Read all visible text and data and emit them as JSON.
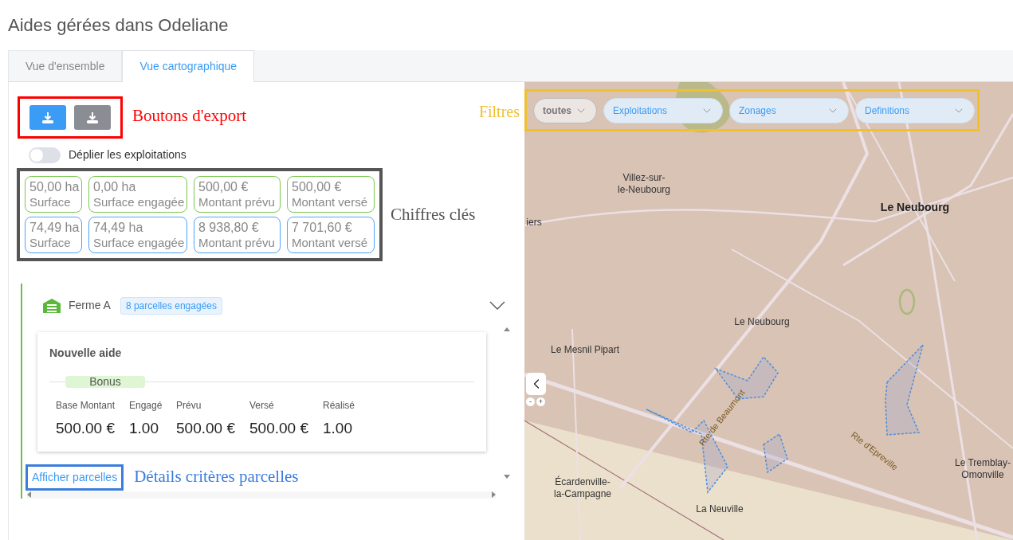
{
  "page_title": "Aides gérées dans Odeliane",
  "tabs": [
    {
      "label": "Vue d'ensemble",
      "selected": false
    },
    {
      "label": "Vue cartographique",
      "selected": true
    }
  ],
  "export_buttons": [
    {
      "color": "#3b9cf6"
    },
    {
      "color": "#8a8d93"
    }
  ],
  "toggle": {
    "label": "Déplier les exploitations",
    "on": false
  },
  "key_figures": [
    {
      "color": "#7ac74f",
      "cards": [
        {
          "value": "50,00 ha",
          "label": "Surface"
        },
        {
          "value": "0,00 ha",
          "label": "Surface engagée"
        },
        {
          "value": "500,00 €",
          "label": "Montant prévu"
        },
        {
          "value": "500,00 €",
          "label": "Montant versé"
        }
      ]
    },
    {
      "color": "#4da3f7",
      "cards": [
        {
          "value": "74,49 ha",
          "label": "Surface"
        },
        {
          "value": "74,49 ha",
          "label": "Surface engagée"
        },
        {
          "value": "8 938,80 €",
          "label": "Montant prévu"
        },
        {
          "value": "7 701,60 €",
          "label": "Montant versé"
        }
      ]
    }
  ],
  "farm": {
    "name": "Ferme A",
    "badge": "8 parcelles engagées",
    "expanded": true,
    "aid": {
      "title": "Nouvelle aide",
      "tag": "Bonus",
      "columns": [
        {
          "label": "Base Montant",
          "value": "500.00 €"
        },
        {
          "label": "Engagé",
          "value": "1.00"
        },
        {
          "label": "Prévu",
          "value": "500.00 €"
        },
        {
          "label": "Versé",
          "value": "500.00 €"
        },
        {
          "label": "Réalisé",
          "value": "1.00"
        }
      ]
    },
    "link": "Afficher parcelles"
  },
  "filters": [
    {
      "label": "toutes",
      "kind": "value"
    },
    {
      "label": "Exploitations",
      "kind": "placeholder"
    },
    {
      "label": "Zonages",
      "kind": "placeholder"
    },
    {
      "label": "Definitions",
      "kind": "placeholder"
    }
  ],
  "map": {
    "zoom_out": "-",
    "zoom_in": "+",
    "labels": [
      {
        "lines": [
          "Villez-sur-",
          "le-Neubourg"
        ],
        "kind": "town"
      },
      {
        "lines": [
          "Le Neubourg"
        ],
        "kind": "city"
      },
      {
        "lines": [
          "iers"
        ],
        "kind": "town"
      },
      {
        "lines": [
          "Le Neubourg"
        ],
        "kind": "town"
      },
      {
        "lines": [
          "Le Mesnil Pipart"
        ],
        "kind": "town"
      },
      {
        "lines": [
          "Écardenville-",
          "la-Campagne"
        ],
        "kind": "town"
      },
      {
        "lines": [
          "La Neuville"
        ],
        "kind": "town"
      },
      {
        "lines": [
          "Le Tremblay-",
          "Omonville"
        ],
        "kind": "town"
      },
      {
        "lines": [
          "Rte de Beaumont"
        ],
        "kind": "road"
      },
      {
        "lines": [
          "Rte d'Epreville"
        ],
        "kind": "road"
      }
    ]
  },
  "annotations": [
    {
      "text": "Boutons d'export",
      "color": "#ff0000"
    },
    {
      "text": "Chiffres clés",
      "color": "#555555"
    },
    {
      "text": "Filtres",
      "color": "#f0c030"
    },
    {
      "text": "Détails critères parcelles",
      "color": "#3b7ddd"
    }
  ]
}
